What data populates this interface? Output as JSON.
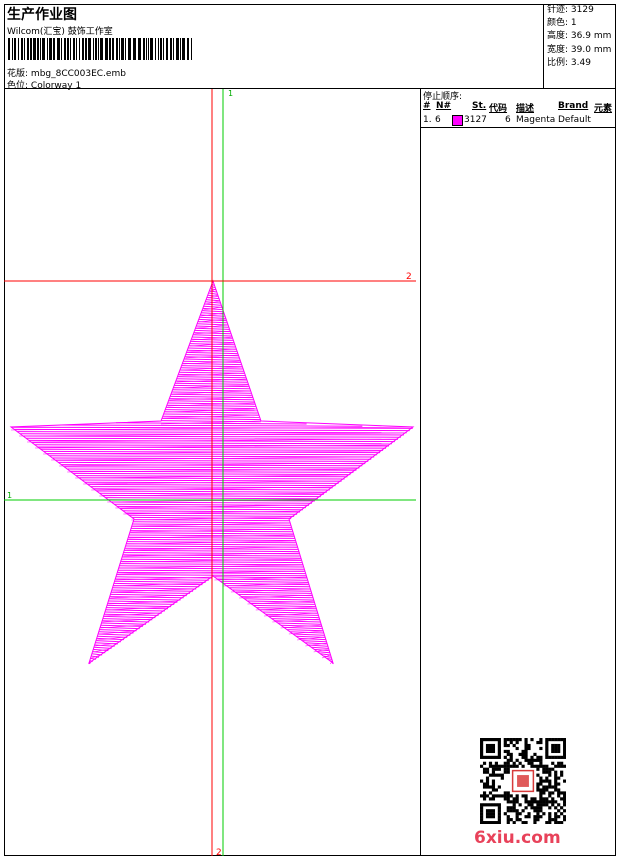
{
  "header": {
    "title": "生产作业图",
    "company": "Wilcom(汇宝) 鼓饰工作室",
    "design_label": "花版:",
    "design_value": "mbg_8CC003EC.emb",
    "colorway_label": "色位:",
    "colorway_value": "Colorway 1"
  },
  "stats": {
    "stitches_label": "针迹:",
    "stitches_value": "3129",
    "colors_label": "颜色:",
    "colors_value": "1",
    "height_label": "高度:",
    "height_value": "36.9 mm",
    "width_label": "宽度:",
    "width_value": "39.0 mm",
    "scale_label": "比例:",
    "scale_value": "3.49"
  },
  "stop_sequence": {
    "title": "停止顺序:",
    "columns": [
      "#",
      "N#",
      "St.",
      "代码",
      "描述",
      "Brand",
      "元素"
    ],
    "rows": [
      {
        "index": "1.",
        "needle": "6",
        "stitches": "3127",
        "code": "6",
        "description": "Magenta",
        "brand": "Default",
        "element": "",
        "color": "#ff00ff"
      }
    ]
  },
  "guides": {
    "v1": "1",
    "v2": "2",
    "h1": "1",
    "h2": "2"
  },
  "design_color": "#ff00ff",
  "watermark": "6xiu.com"
}
